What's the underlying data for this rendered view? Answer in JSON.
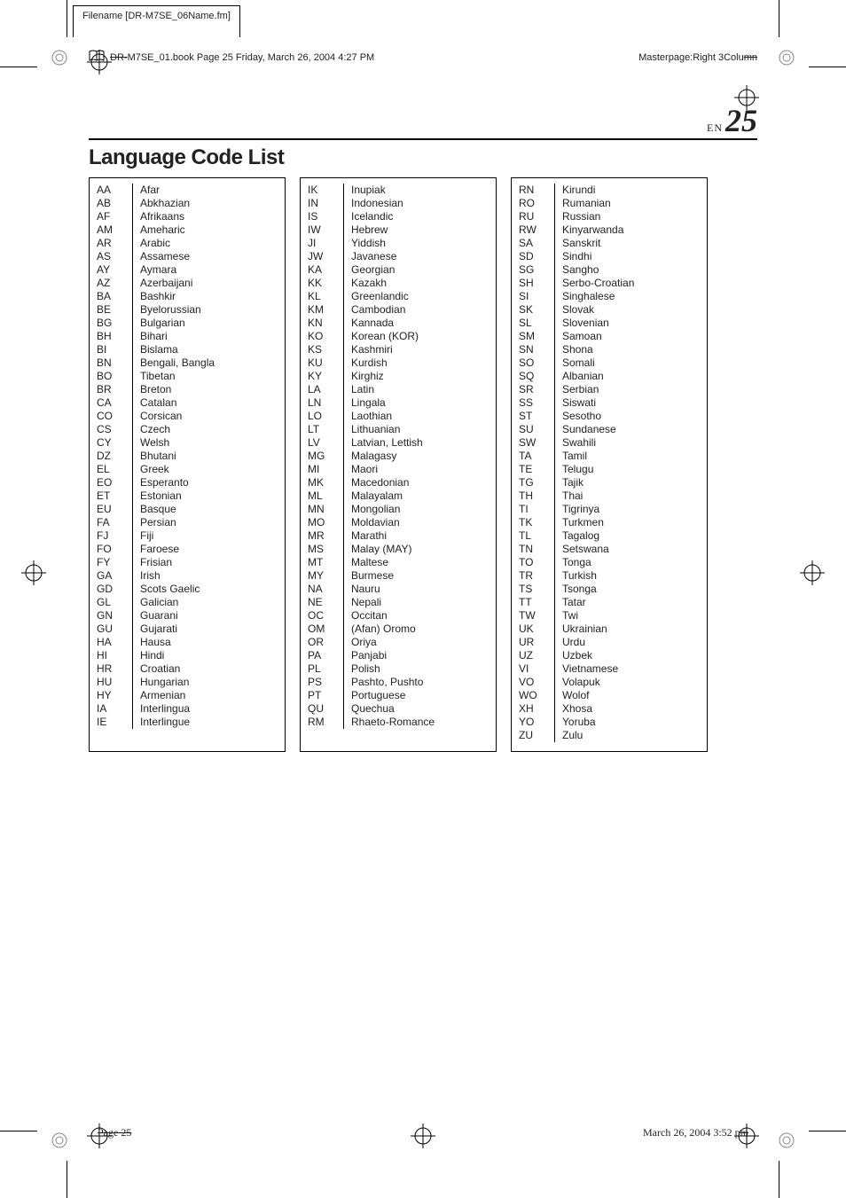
{
  "file_tab": "Filename [DR-M7SE_06Name.fm]",
  "bookline_prefix": "DR-",
  "bookline_rest": "M7SE_01.book  Page 25  Friday, March 26, 2004  4:27 PM",
  "masterpage_label": "Masterpage:Right 3Colu",
  "masterpage_strike": "mn",
  "page_label_en": "EN",
  "page_number": "25",
  "title": "Language Code List",
  "footer_page": "Page 25",
  "footer_date_pre": "March 26, 2004 3:52 p",
  "footer_date_strike": "m",
  "columns": [
    [
      {
        "code": "AA",
        "name": "Afar"
      },
      {
        "code": "AB",
        "name": "Abkhazian"
      },
      {
        "code": "AF",
        "name": "Afrikaans"
      },
      {
        "code": "AM",
        "name": "Ameharic"
      },
      {
        "code": "AR",
        "name": "Arabic"
      },
      {
        "code": "AS",
        "name": "Assamese"
      },
      {
        "code": "AY",
        "name": "Aymara"
      },
      {
        "code": "AZ",
        "name": "Azerbaijani"
      },
      {
        "code": "BA",
        "name": "Bashkir"
      },
      {
        "code": "BE",
        "name": "Byelorussian"
      },
      {
        "code": "BG",
        "name": "Bulgarian"
      },
      {
        "code": "BH",
        "name": "Bihari"
      },
      {
        "code": "BI",
        "name": "Bislama"
      },
      {
        "code": "BN",
        "name": "Bengali, Bangla"
      },
      {
        "code": "BO",
        "name": "Tibetan"
      },
      {
        "code": "BR",
        "name": "Breton"
      },
      {
        "code": "CA",
        "name": "Catalan"
      },
      {
        "code": "CO",
        "name": "Corsican"
      },
      {
        "code": "CS",
        "name": "Czech"
      },
      {
        "code": "CY",
        "name": "Welsh"
      },
      {
        "code": "DZ",
        "name": "Bhutani"
      },
      {
        "code": "EL",
        "name": "Greek"
      },
      {
        "code": "EO",
        "name": "Esperanto"
      },
      {
        "code": "ET",
        "name": "Estonian"
      },
      {
        "code": "EU",
        "name": "Basque"
      },
      {
        "code": "FA",
        "name": "Persian"
      },
      {
        "code": "FJ",
        "name": "Fiji"
      },
      {
        "code": "FO",
        "name": "Faroese"
      },
      {
        "code": "FY",
        "name": "Frisian"
      },
      {
        "code": "GA",
        "name": "Irish"
      },
      {
        "code": "GD",
        "name": "Scots Gaelic"
      },
      {
        "code": "GL",
        "name": "Galician"
      },
      {
        "code": "GN",
        "name": "Guarani"
      },
      {
        "code": "GU",
        "name": "Gujarati"
      },
      {
        "code": "HA",
        "name": "Hausa"
      },
      {
        "code": "HI",
        "name": "Hindi"
      },
      {
        "code": "HR",
        "name": "Croatian"
      },
      {
        "code": "HU",
        "name": "Hungarian"
      },
      {
        "code": "HY",
        "name": "Armenian"
      },
      {
        "code": "IA",
        "name": "Interlingua"
      },
      {
        "code": "IE",
        "name": "Interlingue"
      }
    ],
    [
      {
        "code": "IK",
        "name": "Inupiak"
      },
      {
        "code": "IN",
        "name": "Indonesian"
      },
      {
        "code": "IS",
        "name": "Icelandic"
      },
      {
        "code": "IW",
        "name": "Hebrew"
      },
      {
        "code": "JI",
        "name": "Yiddish"
      },
      {
        "code": "JW",
        "name": "Javanese"
      },
      {
        "code": "KA",
        "name": "Georgian"
      },
      {
        "code": "KK",
        "name": "Kazakh"
      },
      {
        "code": "KL",
        "name": "Greenlandic"
      },
      {
        "code": "KM",
        "name": "Cambodian"
      },
      {
        "code": "KN",
        "name": "Kannada"
      },
      {
        "code": "KO",
        "name": "Korean (KOR)"
      },
      {
        "code": "KS",
        "name": "Kashmiri"
      },
      {
        "code": "KU",
        "name": "Kurdish"
      },
      {
        "code": "KY",
        "name": "Kirghiz"
      },
      {
        "code": "LA",
        "name": "Latin"
      },
      {
        "code": "LN",
        "name": "Lingala"
      },
      {
        "code": "LO",
        "name": "Laothian"
      },
      {
        "code": "LT",
        "name": "Lithuanian"
      },
      {
        "code": "LV",
        "name": "Latvian, Lettish"
      },
      {
        "code": "MG",
        "name": "Malagasy"
      },
      {
        "code": "MI",
        "name": "Maori"
      },
      {
        "code": "MK",
        "name": "Macedonian"
      },
      {
        "code": "ML",
        "name": "Malayalam"
      },
      {
        "code": "MN",
        "name": "Mongolian"
      },
      {
        "code": "MO",
        "name": "Moldavian"
      },
      {
        "code": "MR",
        "name": "Marathi"
      },
      {
        "code": "MS",
        "name": "Malay (MAY)"
      },
      {
        "code": "MT",
        "name": "Maltese"
      },
      {
        "code": "MY",
        "name": "Burmese"
      },
      {
        "code": "NA",
        "name": "Nauru"
      },
      {
        "code": "NE",
        "name": "Nepali"
      },
      {
        "code": "OC",
        "name": "Occitan"
      },
      {
        "code": "OM",
        "name": "(Afan) Oromo"
      },
      {
        "code": "OR",
        "name": "Oriya"
      },
      {
        "code": "PA",
        "name": "Panjabi"
      },
      {
        "code": "PL",
        "name": "Polish"
      },
      {
        "code": "PS",
        "name": "Pashto, Pushto"
      },
      {
        "code": "PT",
        "name": "Portuguese"
      },
      {
        "code": "QU",
        "name": "Quechua"
      },
      {
        "code": "RM",
        "name": "Rhaeto-Romance"
      }
    ],
    [
      {
        "code": "RN",
        "name": "Kirundi"
      },
      {
        "code": "RO",
        "name": "Rumanian"
      },
      {
        "code": "RU",
        "name": "Russian"
      },
      {
        "code": "RW",
        "name": "Kinyarwanda"
      },
      {
        "code": "SA",
        "name": "Sanskrit"
      },
      {
        "code": "SD",
        "name": "Sindhi"
      },
      {
        "code": "SG",
        "name": "Sangho"
      },
      {
        "code": "SH",
        "name": "Serbo-Croatian"
      },
      {
        "code": "SI",
        "name": "Singhalese"
      },
      {
        "code": "SK",
        "name": "Slovak"
      },
      {
        "code": "SL",
        "name": "Slovenian"
      },
      {
        "code": "SM",
        "name": "Samoan"
      },
      {
        "code": "SN",
        "name": "Shona"
      },
      {
        "code": "SO",
        "name": "Somali"
      },
      {
        "code": "SQ",
        "name": "Albanian"
      },
      {
        "code": "SR",
        "name": "Serbian"
      },
      {
        "code": "SS",
        "name": "Siswati"
      },
      {
        "code": "ST",
        "name": "Sesotho"
      },
      {
        "code": "SU",
        "name": "Sundanese"
      },
      {
        "code": "SW",
        "name": "Swahili"
      },
      {
        "code": "TA",
        "name": "Tamil"
      },
      {
        "code": "TE",
        "name": "Telugu"
      },
      {
        "code": "TG",
        "name": "Tajik"
      },
      {
        "code": "TH",
        "name": "Thai"
      },
      {
        "code": "TI",
        "name": "Tigrinya"
      },
      {
        "code": "TK",
        "name": "Turkmen"
      },
      {
        "code": "TL",
        "name": "Tagalog"
      },
      {
        "code": "TN",
        "name": "Setswana"
      },
      {
        "code": "TO",
        "name": "Tonga"
      },
      {
        "code": "TR",
        "name": "Turkish"
      },
      {
        "code": "TS",
        "name": "Tsonga"
      },
      {
        "code": "TT",
        "name": "Tatar"
      },
      {
        "code": "TW",
        "name": "Twi"
      },
      {
        "code": "UK",
        "name": "Ukrainian"
      },
      {
        "code": "UR",
        "name": "Urdu"
      },
      {
        "code": "UZ",
        "name": "Uzbek"
      },
      {
        "code": "VI",
        "name": "Vietnamese"
      },
      {
        "code": "VO",
        "name": "Volapuk"
      },
      {
        "code": "WO",
        "name": "Wolof"
      },
      {
        "code": "XH",
        "name": "Xhosa"
      },
      {
        "code": "YO",
        "name": "Yoruba"
      },
      {
        "code": "ZU",
        "name": "Zulu"
      }
    ]
  ]
}
